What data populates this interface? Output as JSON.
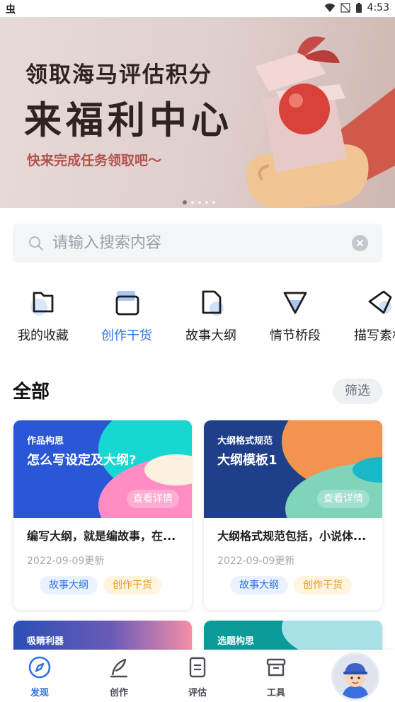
{
  "status_bar": {
    "left_glyph": "虫",
    "time": "4:53"
  },
  "banner": {
    "line1": "领取海马评估积分",
    "line2": "来福利中心",
    "line3": "快来完成任务领取吧～",
    "dots": 5,
    "active_dot": 0
  },
  "search": {
    "placeholder": "请输入搜索内容",
    "value": ""
  },
  "categories": [
    {
      "label": "我的收藏",
      "icon": "folder-icon"
    },
    {
      "label": "创作干货",
      "icon": "box-icon",
      "active": true
    },
    {
      "label": "故事大纲",
      "icon": "document-icon"
    },
    {
      "label": "情节桥段",
      "icon": "shield-icon"
    },
    {
      "label": "描写素材",
      "icon": "tag-icon"
    }
  ],
  "section": {
    "title": "全部",
    "filter_label": "筛选"
  },
  "cards": [
    {
      "category": "作品构思",
      "title": "怎么写设定及大纲?",
      "detail_label": "查看详情",
      "desc": "编写大纲，就是编故事，在...",
      "date": "2022-09-09更新",
      "tags": [
        "故事大纲",
        "创作干货"
      ],
      "colors": {
        "base": "#2a57d6",
        "blob1": "#16d7d1",
        "blob2": "#ff8dc3"
      }
    },
    {
      "category": "大纲格式规范",
      "title": "大纲模板1",
      "detail_label": "查看详情",
      "desc": "大纲格式规范包括，小说体...",
      "date": "2022-09-09更新",
      "tags": [
        "故事大纲",
        "创作干货"
      ],
      "colors": {
        "base": "#1f3f8a",
        "blob1": "#f39350",
        "blob2": "#7fd4bb"
      }
    },
    {
      "category": "吸睛利器",
      "colors": {
        "base": "#2c4fb5",
        "blob1": "#f48fa7"
      }
    },
    {
      "category": "选题构思",
      "colors": {
        "base": "#0a9a9a",
        "blob1": "#a8e2e8"
      }
    }
  ],
  "bottom_nav": [
    {
      "label": "发现",
      "icon": "compass-icon",
      "active": true
    },
    {
      "label": "创作",
      "icon": "quill-icon"
    },
    {
      "label": "评估",
      "icon": "clipboard-icon"
    },
    {
      "label": "工具",
      "icon": "toolbox-icon"
    }
  ],
  "accent_color": "#2f72e6"
}
